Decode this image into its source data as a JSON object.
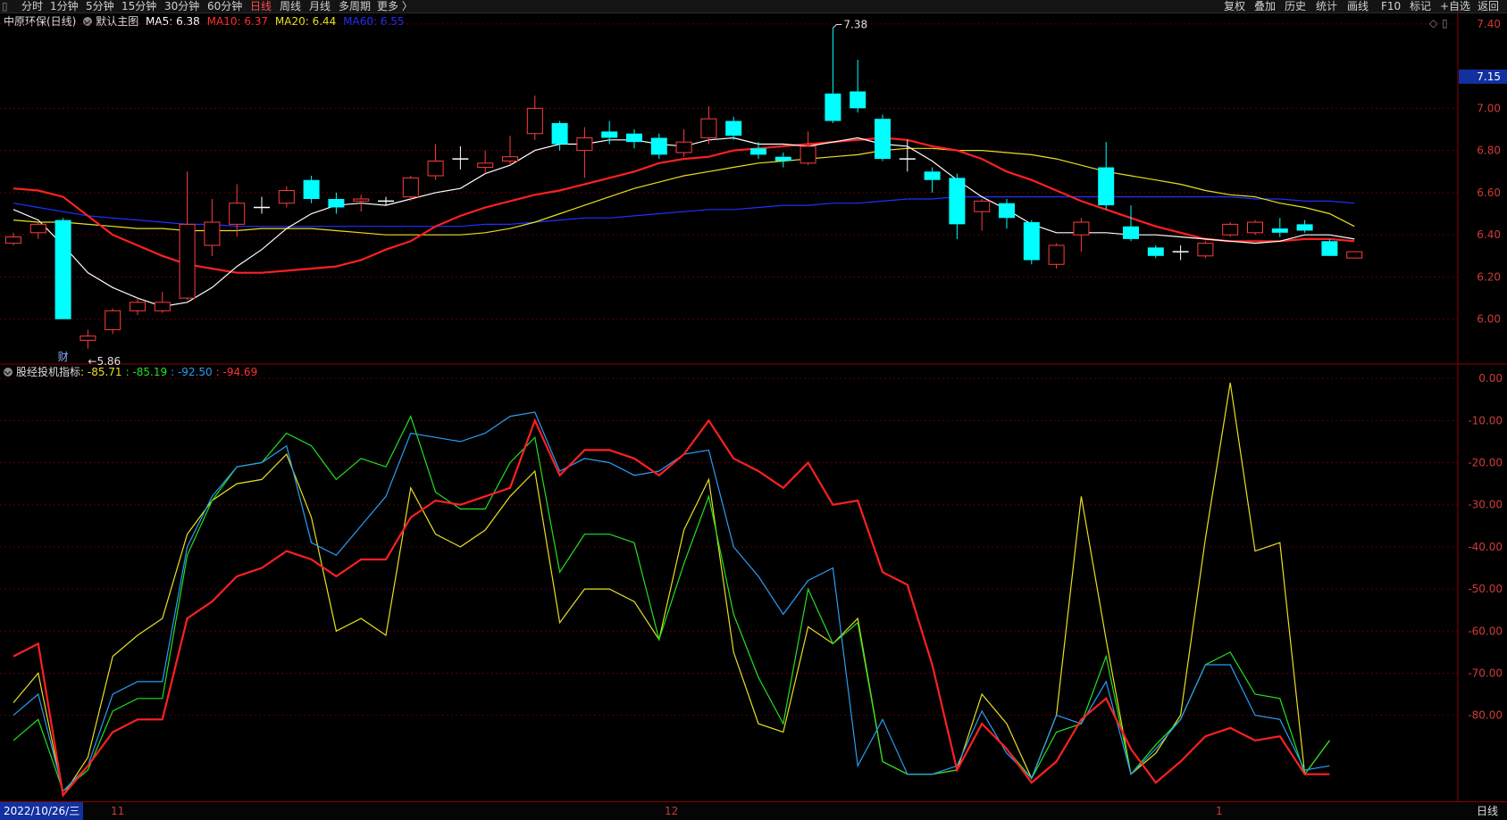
{
  "toolbar": {
    "left": [
      "分时",
      "1分钟",
      "5分钟",
      "15分钟",
      "30分钟",
      "60分钟",
      "日线",
      "周线",
      "月线",
      "多周期",
      "更多 〉"
    ],
    "active": "日线",
    "right": [
      "复权",
      "叠加",
      "历史",
      "统计",
      "画线",
      "F10",
      "标记",
      "+自选",
      "返回"
    ]
  },
  "main_legend": {
    "stock": "中原环保(日线)",
    "template": "默认主图",
    "ma5": "MA5: 6.38",
    "ma10": "MA10: 6.37",
    "ma20": "MA20: 6.44",
    "ma60": "MA60: 6.55"
  },
  "indicator_legend": {
    "name": "股经投机指标",
    "v1": ": -85.71",
    "v2": ": -85.19",
    "v3": ": -92.50",
    "v4": ": -94.69"
  },
  "bottom": {
    "date": "2022/10/26/三",
    "months": [
      "11",
      "12",
      "1"
    ],
    "period": "日线"
  },
  "colors": {
    "up": "#ff3c3c",
    "down": "#00ffff",
    "ma5": "#ffffff",
    "ma10": "#ff2020",
    "ma20": "#e8e020",
    "ma60": "#2030ff",
    "ind1": "#e8e020",
    "ind2": "#22e022",
    "ind3": "#2a9df4",
    "ind4": "#ff2020"
  },
  "chart_data": [
    {
      "type": "candlestick",
      "ylim": [
        5.8,
        7.45
      ],
      "yticks": [
        "7.40",
        "7.15",
        "7.00",
        "6.80",
        "6.60",
        "6.40",
        "6.20",
        "6.00"
      ],
      "ytick_values": [
        7.4,
        7.15,
        7.0,
        6.8,
        6.6,
        6.4,
        6.2,
        6.0
      ],
      "highlight_tick": "7.15",
      "annotations": [
        {
          "text": "7.38",
          "index": 33,
          "value": 7.38
        },
        {
          "text": "←5.86",
          "index": 3,
          "value": 5.86
        },
        {
          "text": "财",
          "index": 2,
          "value": 5.8
        }
      ],
      "candles": [
        [
          6.36,
          6.39,
          6.41,
          6.35
        ],
        [
          6.41,
          6.45,
          6.46,
          6.38
        ],
        [
          6.47,
          6.0,
          6.48,
          6.0
        ],
        [
          5.9,
          5.92,
          5.95,
          5.86
        ],
        [
          5.95,
          6.04,
          6.05,
          5.93
        ],
        [
          6.04,
          6.08,
          6.1,
          6.02
        ],
        [
          6.04,
          6.08,
          6.13,
          6.03
        ],
        [
          6.1,
          6.45,
          6.7,
          6.09
        ],
        [
          6.35,
          6.46,
          6.57,
          6.3
        ],
        [
          6.45,
          6.55,
          6.64,
          6.39
        ],
        [
          6.53,
          6.53,
          6.58,
          6.5
        ],
        [
          6.55,
          6.61,
          6.63,
          6.53
        ],
        [
          6.66,
          6.57,
          6.68,
          6.55
        ],
        [
          6.57,
          6.53,
          6.6,
          6.5
        ],
        [
          6.56,
          6.57,
          6.59,
          6.51
        ],
        [
          6.56,
          6.56,
          6.58,
          6.54
        ],
        [
          6.58,
          6.67,
          6.68,
          6.56
        ],
        [
          6.68,
          6.75,
          6.83,
          6.66
        ],
        [
          6.76,
          6.76,
          6.82,
          6.71
        ],
        [
          6.72,
          6.74,
          6.8,
          6.69
        ],
        [
          6.75,
          6.77,
          6.87,
          6.73
        ],
        [
          6.88,
          7.0,
          7.06,
          6.85
        ],
        [
          6.93,
          6.83,
          6.94,
          6.8
        ],
        [
          6.8,
          6.86,
          6.91,
          6.67
        ],
        [
          6.89,
          6.86,
          6.94,
          6.83
        ],
        [
          6.88,
          6.84,
          6.9,
          6.81
        ],
        [
          6.86,
          6.78,
          6.88,
          6.76
        ],
        [
          6.79,
          6.84,
          6.9,
          6.77
        ],
        [
          6.86,
          6.95,
          7.01,
          6.83
        ],
        [
          6.94,
          6.87,
          6.96,
          6.85
        ],
        [
          6.81,
          6.78,
          6.84,
          6.76
        ],
        [
          6.77,
          6.75,
          6.79,
          6.72
        ],
        [
          6.74,
          6.82,
          6.89,
          6.73
        ],
        [
          7.07,
          6.94,
          7.38,
          6.93
        ],
        [
          7.08,
          7.0,
          7.23,
          6.98
        ],
        [
          6.95,
          6.76,
          6.97,
          6.75
        ],
        [
          6.76,
          6.76,
          6.85,
          6.7
        ],
        [
          6.7,
          6.66,
          6.72,
          6.6
        ],
        [
          6.67,
          6.45,
          6.69,
          6.38
        ],
        [
          6.51,
          6.56,
          6.57,
          6.42
        ],
        [
          6.55,
          6.48,
          6.57,
          6.43
        ],
        [
          6.46,
          6.28,
          6.47,
          6.26
        ],
        [
          6.26,
          6.35,
          6.36,
          6.24
        ],
        [
          6.4,
          6.46,
          6.48,
          6.32
        ],
        [
          6.72,
          6.54,
          6.84,
          6.52
        ],
        [
          6.44,
          6.38,
          6.54,
          6.37
        ],
        [
          6.34,
          6.3,
          6.35,
          6.29
        ],
        [
          6.32,
          6.32,
          6.35,
          6.28
        ],
        [
          6.3,
          6.36,
          6.37,
          6.29
        ],
        [
          6.4,
          6.45,
          6.46,
          6.39
        ],
        [
          6.41,
          6.46,
          6.47,
          6.4
        ],
        [
          6.43,
          6.41,
          6.48,
          6.39
        ],
        [
          6.45,
          6.42,
          6.47,
          6.41
        ],
        [
          6.37,
          6.3,
          6.38,
          6.3
        ],
        [
          6.29,
          6.32,
          6.32,
          6.29
        ]
      ],
      "ma5": [
        6.52,
        6.47,
        6.35,
        6.22,
        6.15,
        6.1,
        6.06,
        6.08,
        6.15,
        6.25,
        6.33,
        6.43,
        6.5,
        6.54,
        6.55,
        6.54,
        6.57,
        6.6,
        6.62,
        6.69,
        6.73,
        6.8,
        6.83,
        6.83,
        6.85,
        6.85,
        6.83,
        6.82,
        6.85,
        6.86,
        6.83,
        6.83,
        6.82,
        6.84,
        6.86,
        6.83,
        6.82,
        6.75,
        6.66,
        6.58,
        6.52,
        6.45,
        6.41,
        6.41,
        6.41,
        6.4,
        6.4,
        6.39,
        6.38,
        6.37,
        6.36,
        6.37,
        6.4,
        6.4,
        6.38
      ],
      "ma10": [
        6.62,
        6.61,
        6.58,
        6.49,
        6.4,
        6.35,
        6.3,
        6.26,
        6.24,
        6.22,
        6.22,
        6.23,
        6.24,
        6.25,
        6.28,
        6.33,
        6.37,
        6.44,
        6.49,
        6.53,
        6.56,
        6.59,
        6.61,
        6.64,
        6.67,
        6.7,
        6.74,
        6.76,
        6.77,
        6.8,
        6.81,
        6.82,
        6.83,
        6.84,
        6.85,
        6.86,
        6.85,
        6.82,
        6.8,
        6.76,
        6.7,
        6.66,
        6.61,
        6.56,
        6.52,
        6.48,
        6.44,
        6.41,
        6.38,
        6.37,
        6.37,
        6.37,
        6.38,
        6.38,
        6.37
      ],
      "ma20": [
        6.47,
        6.46,
        6.46,
        6.45,
        6.44,
        6.43,
        6.43,
        6.42,
        6.42,
        6.42,
        6.43,
        6.43,
        6.43,
        6.42,
        6.41,
        6.4,
        6.4,
        6.4,
        6.4,
        6.41,
        6.43,
        6.46,
        6.5,
        6.54,
        6.58,
        6.62,
        6.65,
        6.68,
        6.7,
        6.72,
        6.74,
        6.75,
        6.76,
        6.77,
        6.78,
        6.8,
        6.81,
        6.81,
        6.8,
        6.8,
        6.79,
        6.78,
        6.76,
        6.73,
        6.7,
        6.68,
        6.66,
        6.64,
        6.61,
        6.59,
        6.58,
        6.55,
        6.53,
        6.5,
        6.44
      ],
      "ma60": [
        6.55,
        6.53,
        6.51,
        6.49,
        6.48,
        6.47,
        6.46,
        6.45,
        6.45,
        6.44,
        6.44,
        6.44,
        6.44,
        6.44,
        6.44,
        6.44,
        6.44,
        6.44,
        6.44,
        6.45,
        6.45,
        6.46,
        6.47,
        6.48,
        6.48,
        6.49,
        6.5,
        6.51,
        6.52,
        6.52,
        6.53,
        6.54,
        6.54,
        6.55,
        6.55,
        6.56,
        6.57,
        6.57,
        6.58,
        6.58,
        6.58,
        6.58,
        6.58,
        6.58,
        6.58,
        6.58,
        6.58,
        6.58,
        6.58,
        6.58,
        6.57,
        6.57,
        6.56,
        6.56,
        6.55
      ]
    },
    {
      "type": "line",
      "ylim": [
        -100,
        3
      ],
      "yticks": [
        "0.00",
        "-10.00",
        "-20.00",
        "-30.00",
        "-40.00",
        "-50.00",
        "-60.00",
        "-70.00",
        "-80.00"
      ],
      "ytick_values": [
        0,
        -10,
        -20,
        -30,
        -40,
        -50,
        -60,
        -70,
        -80
      ],
      "series": [
        {
          "values": [
            -77,
            -70,
            -99,
            -90,
            -66,
            -61,
            -57,
            -37,
            -29,
            -25,
            -24,
            -18,
            -33,
            -60,
            -57,
            -61,
            -26,
            -37,
            -40,
            -36,
            -28,
            -22,
            -58,
            -50,
            -50,
            -53,
            -62,
            -36,
            -24,
            -65,
            -82,
            -84,
            -59,
            -63,
            -57,
            -91,
            -94,
            -94,
            -93,
            -75,
            -82,
            -95,
            -80,
            -28,
            -62,
            -94,
            -89,
            -80,
            -38,
            -1,
            -41,
            -39,
            -94,
            -86
          ]
        },
        {
          "values": [
            -86,
            -81,
            -98,
            -93,
            -79,
            -76,
            -76,
            -42,
            -29,
            -21,
            -20,
            -13,
            -16,
            -24,
            -19,
            -21,
            -9,
            -27,
            -31,
            -31,
            -20,
            -14,
            -46,
            -37,
            -37,
            -39,
            -62,
            -44,
            -28,
            -56,
            -71,
            -82,
            -50,
            -63,
            -58,
            -91,
            -94,
            -94,
            -93,
            -82,
            -88,
            -95,
            -84,
            -82,
            -66,
            -94,
            -87,
            -81,
            -68,
            -65,
            -75,
            -76,
            -94,
            -86
          ]
        },
        {
          "values": [
            -80,
            -75,
            -98,
            -92,
            -75,
            -72,
            -72,
            -40,
            -28,
            -21,
            -20,
            -16,
            -39,
            -42,
            -35,
            -28,
            -13,
            -14,
            -15,
            -13,
            -9,
            -8,
            -22,
            -19,
            -20,
            -23,
            -22,
            -18,
            -17,
            -40,
            -47,
            -56,
            -48,
            -45,
            -92,
            -81,
            -94,
            -94,
            -92,
            -79,
            -89,
            -95,
            -80,
            -82,
            -72,
            -94,
            -88,
            -81,
            -68,
            -68,
            -80,
            -81,
            -93,
            -92
          ]
        },
        {
          "values": [
            -66,
            -63,
            -99,
            -92,
            -84,
            -81,
            -81,
            -57,
            -53,
            -47,
            -45,
            -41,
            -43,
            -47,
            -43,
            -43,
            -33,
            -29,
            -30,
            -28,
            -26,
            -10,
            -23,
            -17,
            -17,
            -19,
            -23,
            -18,
            -10,
            -19,
            -22,
            -26,
            -20,
            -30,
            -29,
            -46,
            -49,
            -68,
            -93,
            -82,
            -88,
            -96,
            -91,
            -81,
            -76,
            -88,
            -96,
            -91,
            -85,
            -83,
            -86,
            -85,
            -94,
            -94
          ]
        }
      ]
    }
  ]
}
